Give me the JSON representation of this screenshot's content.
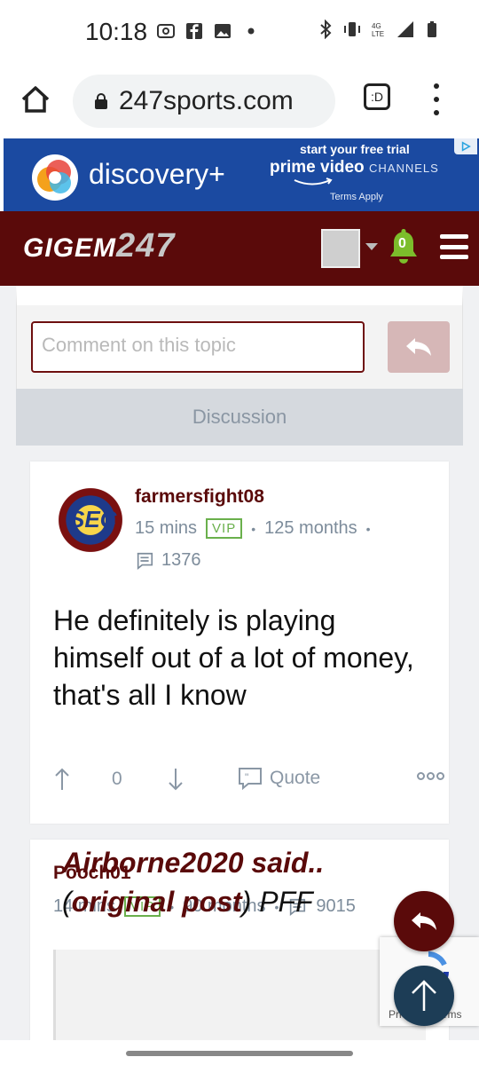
{
  "status_bar": {
    "time": "10:18"
  },
  "browser": {
    "url": "247sports.com",
    "tab_label": ":D"
  },
  "ad": {
    "brand": "discovery+",
    "trial": "start your free trial",
    "prime": "prime video",
    "channels": "CHANNELS",
    "terms": "Terms Apply",
    "colors": {
      "background": "#1b4aa1"
    }
  },
  "site": {
    "logo_text": "GIGEM",
    "logo_num": "247",
    "notification_count": "0",
    "colors": {
      "header": "#5a0a0a",
      "accent": "#6e0f0f"
    }
  },
  "comment": {
    "placeholder": "Comment on this topic"
  },
  "discussion": {
    "label": "Discussion"
  },
  "posts": [
    {
      "author": "farmersfight08",
      "avatar_text": "SEC",
      "time": "15 mins",
      "badge": "VIP",
      "tenure": "125 months",
      "post_count": "1376",
      "body": "He definitely is playing himself out of a lot of money, that's all I know",
      "votes": "0",
      "quote_label": "Quote"
    },
    {
      "author": "Pooch01",
      "time": "14 mins",
      "badge": "VIP",
      "tenure": "90 months",
      "post_count": "9015",
      "quote_author": "Airborne2020 said..",
      "quote_orig": "original post",
      "quote_rest": "PFF"
    }
  ],
  "recaptcha": {
    "text": "Privacy - Terms"
  }
}
